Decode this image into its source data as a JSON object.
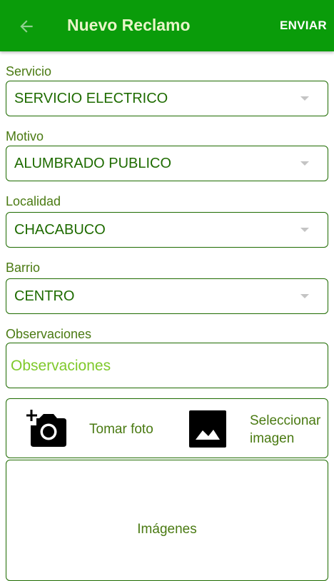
{
  "appbar": {
    "back_icon": "arrow-left-icon",
    "title": "Nuevo Reclamo",
    "action_label": "ENVIAR"
  },
  "form": {
    "servicio": {
      "label": "Servicio",
      "value": "SERVICIO ELECTRICO"
    },
    "motivo": {
      "label": "Motivo",
      "value": "ALUMBRADO PUBLICO"
    },
    "localidad": {
      "label": "Localidad",
      "value": "CHACABUCO"
    },
    "barrio": {
      "label": "Barrio",
      "value": "CENTRO"
    },
    "observaciones": {
      "label": "Observaciones",
      "placeholder": "Observaciones"
    }
  },
  "photos": {
    "camera_icon": "add-a-photo-icon",
    "take_label": "Tomar foto",
    "gallery_icon": "image-icon",
    "select_label_line1": "Seleccionar",
    "select_label_line2": "imagen"
  },
  "images": {
    "label": "Imágenes"
  },
  "colors": {
    "appbar": "#0a9c0a",
    "title": "#e8f5c8",
    "border": "#1e6b00",
    "label": "#4a7a12",
    "placeholder": "#7fc92b"
  }
}
